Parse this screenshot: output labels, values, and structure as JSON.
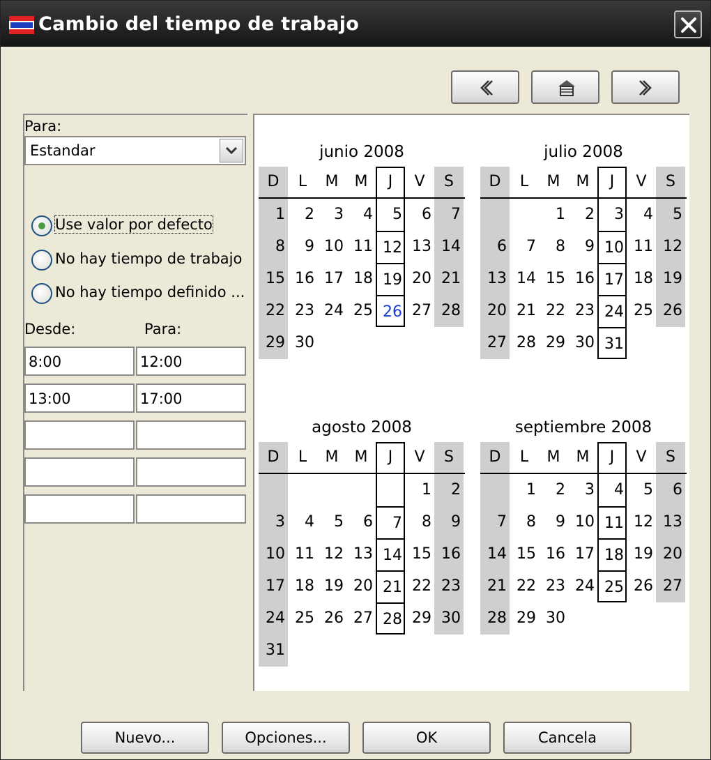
{
  "window": {
    "title": "Cambio del tiempo de trabajo"
  },
  "icons": {
    "app": "app-icon",
    "close": "close-icon",
    "prev": "chevron-left-icon",
    "home": "home-icon",
    "next": "chevron-right-icon",
    "dropdown": "chevron-down-icon"
  },
  "left": {
    "para_label": "Para:",
    "calendar_select": "Estandar",
    "options": [
      {
        "label": "Use valor por defecto",
        "checked": true
      },
      {
        "label": "No hay tiempo de trabajo",
        "checked": false
      },
      {
        "label": "No hay tiempo definido ...",
        "checked": false
      }
    ],
    "desde_label": "Desde:",
    "hasta_label": "Para:",
    "shifts": [
      {
        "from": "8:00",
        "to": "12:00"
      },
      {
        "from": "13:00",
        "to": "17:00"
      },
      {
        "from": "",
        "to": ""
      },
      {
        "from": "",
        "to": ""
      },
      {
        "from": "",
        "to": ""
      }
    ]
  },
  "calendar": {
    "weekdays": [
      "D",
      "L",
      "M",
      "M",
      "J",
      "V",
      "S"
    ],
    "months": [
      {
        "title": "junio 2008",
        "start": 0,
        "days": 30,
        "today": 26
      },
      {
        "title": "julio 2008",
        "start": 2,
        "days": 31,
        "today": null
      },
      {
        "title": "agosto 2008",
        "start": 5,
        "days": 31,
        "today": null
      },
      {
        "title": "septiembre 2008",
        "start": 1,
        "days": 30,
        "today": null
      }
    ]
  },
  "footer": {
    "new": "Nuevo...",
    "options": "Opciones...",
    "ok": "OK",
    "cancel": "Cancela"
  },
  "colors": {
    "weekend_shade": "#cfcfcf",
    "today": "#1f3fd6",
    "titlebar": "#1a1a1a",
    "radio_dot": "#4b9d3e"
  }
}
